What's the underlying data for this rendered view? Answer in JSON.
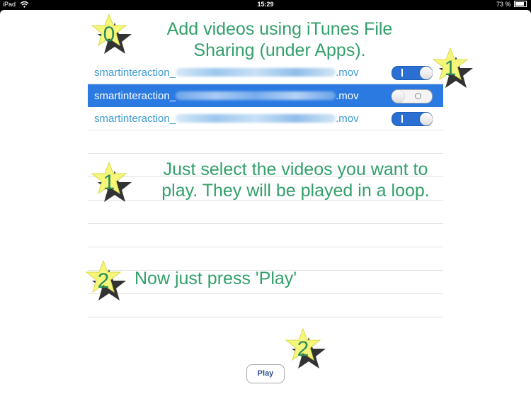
{
  "status_bar": {
    "carrier": "iPad",
    "time": "15:29",
    "battery": "73 %"
  },
  "header": {
    "caption": "Add videos using iTunes File\nSharing (under Apps).",
    "star_number": "0"
  },
  "videos": [
    {
      "prefix": "smartinteraction_",
      "suffix": ".mov",
      "enabled": true,
      "selected": false
    },
    {
      "prefix": "smartinteraction_",
      "suffix": ".mov",
      "enabled": false,
      "selected": true
    },
    {
      "prefix": "smartinteraction_",
      "suffix": ".mov",
      "enabled": true,
      "selected": false
    }
  ],
  "step1": {
    "caption": "Just select the videos you want to\nplay. They will be played in a loop.",
    "star_number": "1",
    "toggle_star_number": "1"
  },
  "step2": {
    "caption": "Now just press 'Play'",
    "star_number": "2",
    "play_star_number": "2"
  },
  "play_button": {
    "label": "Play"
  },
  "colors": {
    "caption_green": "#32a06a",
    "link_blue": "#3c9bd3",
    "selected_blue": "#2a7ae2",
    "star_yellow": "#f6f77a",
    "star_shadow": "#333333"
  }
}
